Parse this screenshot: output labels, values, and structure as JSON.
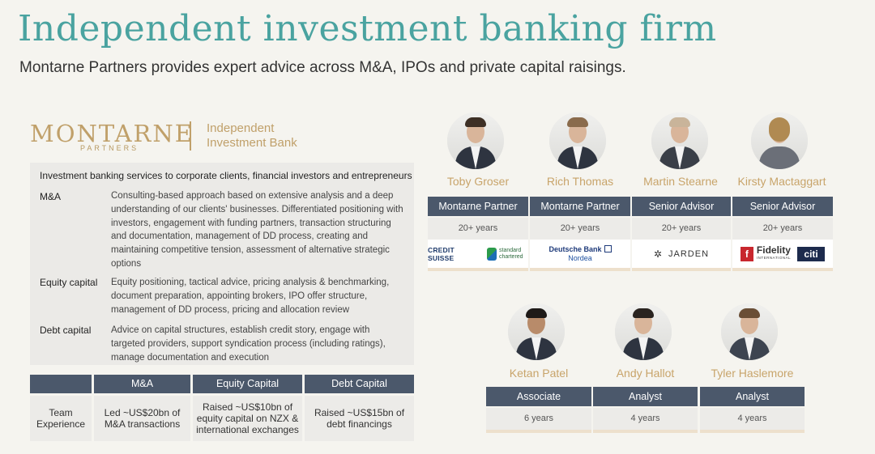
{
  "header": {
    "title": "Independent investment banking firm",
    "subtitle": "Montarne Partners provides expert advice across M&A, IPOs and private capital raisings."
  },
  "logo": {
    "name": "MONTARNE",
    "sub": "PARTNERS",
    "tagline_1": "Independent",
    "tagline_2": "Investment Bank"
  },
  "services": {
    "heading": "Investment banking services to corporate clients, financial investors and entrepreneurs",
    "items": [
      {
        "label": "M&A",
        "text": "Consulting-based approach based on extensive analysis and a deep understanding of our clients' businesses. Differentiated positioning with investors, engagement with funding partners, transaction structuring and documentation, management of DD process, creating and maintaining competitive tension, assessment of alternative strategic options"
      },
      {
        "label": "Equity capital",
        "text": "Equity positioning, tactical advice, pricing analysis & benchmarking, document preparation, appointing brokers, IPO offer structure, management of DD process, pricing and allocation review"
      },
      {
        "label": "Debt capital",
        "text": "Advice on capital structures, establish credit story, engage with targeted providers, support syndication process (including ratings), manage documentation and execution"
      }
    ]
  },
  "team_table": {
    "headers": [
      "M&A",
      "Equity Capital",
      "Debt Capital"
    ],
    "row_label": "Team Experience",
    "cells": [
      "Led ~US$20bn of M&A transactions",
      "Raised ~US$10bn of equity capital on NZX & international exchanges",
      "Raised ~US$15bn of debt financings"
    ]
  },
  "partners": [
    {
      "name": "Toby Groser",
      "role": "Montarne Partner",
      "years": "20+ years",
      "logos": [
        "CREDIT SUISSE",
        "standard chartered"
      ]
    },
    {
      "name": "Rich Thomas",
      "role": "Montarne Partner",
      "years": "20+ years",
      "logos": [
        "Deutsche Bank",
        "Nordea"
      ]
    },
    {
      "name": "Martin Stearne",
      "role": "Senior Advisor",
      "years": "20+ years",
      "logos": [
        "JARDEN"
      ]
    },
    {
      "name": "Kirsty Mactaggart",
      "role": "Senior Advisor",
      "years": "20+ years",
      "logos": [
        "Fidelity",
        "INTERNATIONAL",
        "citi"
      ]
    }
  ],
  "juniors": [
    {
      "name": "Ketan Patel",
      "role": "Associate",
      "years": "6 years"
    },
    {
      "name": "Andy Hallot",
      "role": "Analyst",
      "years": "4 years"
    },
    {
      "name": "Tyler Haslemore",
      "role": "Analyst",
      "years": "4 years"
    }
  ],
  "colors": {
    "title": "#4aa3a0",
    "gold": "#c8a46a",
    "header_fill": "#4b586b",
    "panel_fill": "#ecebe8"
  }
}
